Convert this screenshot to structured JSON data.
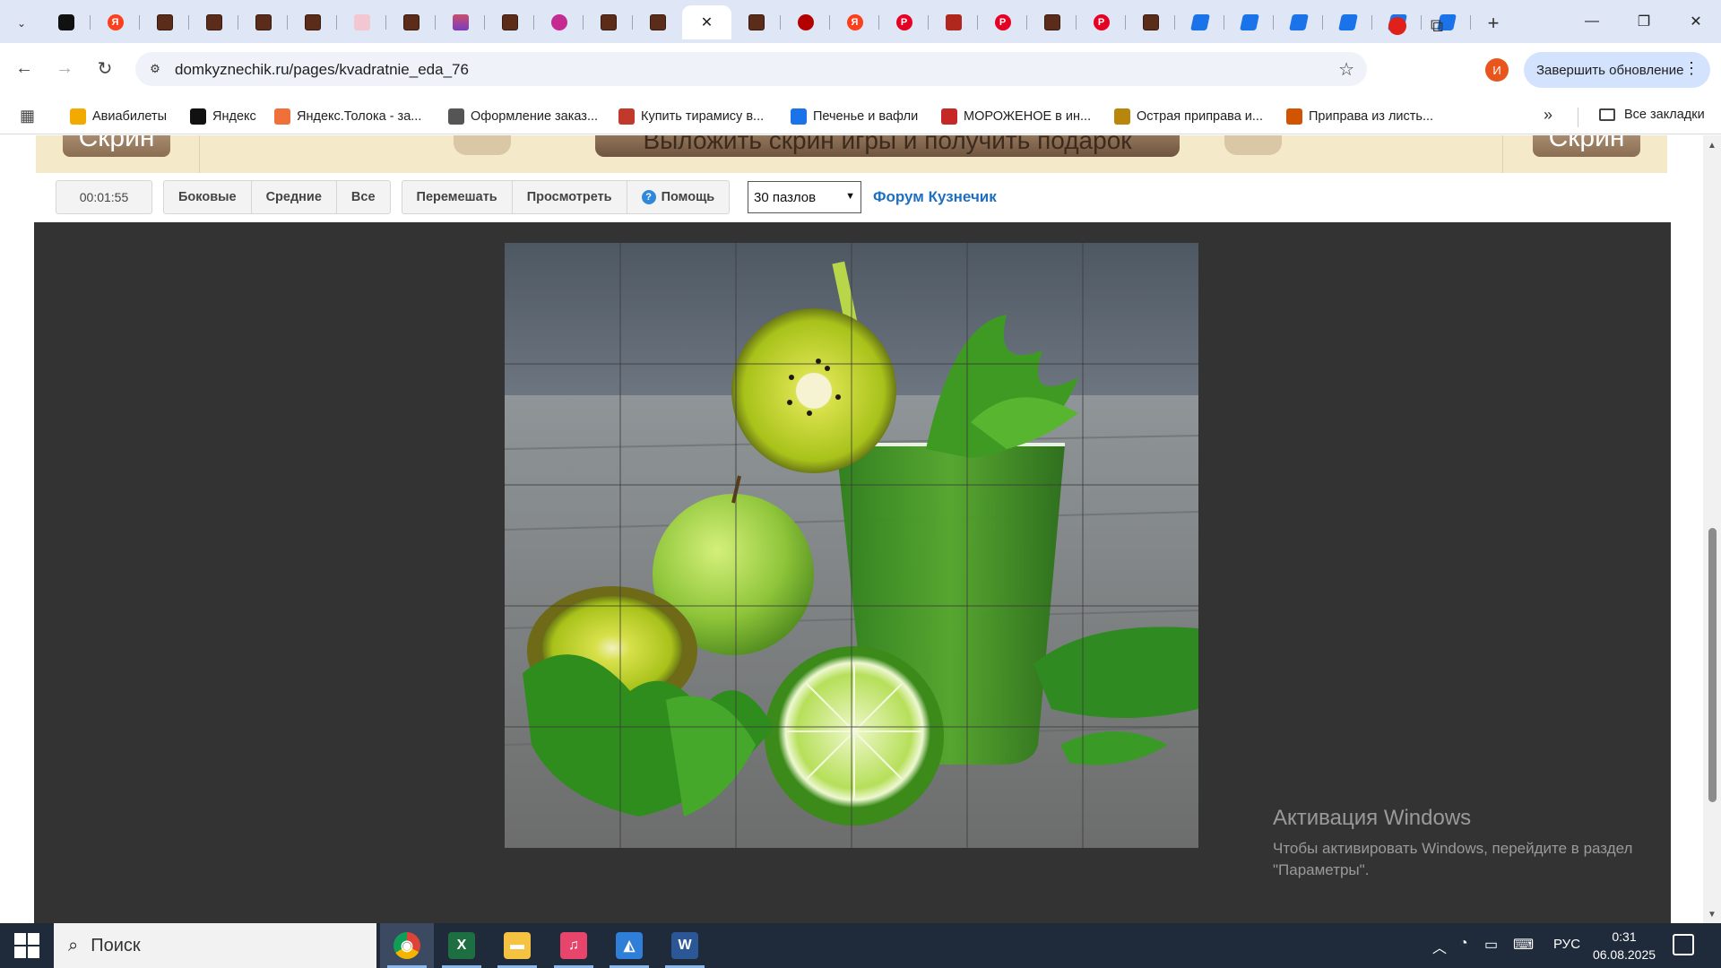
{
  "tabs": [
    {
      "icon": "plus",
      "label": ""
    },
    {
      "icon": "yandex",
      "label": "Я"
    },
    {
      "icon": "site",
      "label": ""
    },
    {
      "icon": "site",
      "label": ""
    },
    {
      "icon": "site",
      "label": ""
    },
    {
      "icon": "site",
      "label": ""
    },
    {
      "icon": "doc",
      "label": ""
    },
    {
      "icon": "site",
      "label": ""
    },
    {
      "icon": "bars",
      "label": ""
    },
    {
      "icon": "site",
      "label": ""
    },
    {
      "icon": "flower",
      "label": ""
    },
    {
      "icon": "site",
      "label": ""
    },
    {
      "icon": "site",
      "label": ""
    },
    {
      "icon": "close",
      "label": "✕",
      "active": true
    },
    {
      "icon": "site",
      "label": ""
    },
    {
      "icon": "red",
      "label": ""
    },
    {
      "icon": "yandex",
      "label": "Я"
    },
    {
      "icon": "pin",
      "label": "P"
    },
    {
      "icon": "man",
      "label": ""
    },
    {
      "icon": "pin",
      "label": "P"
    },
    {
      "icon": "site",
      "label": ""
    },
    {
      "icon": "pin",
      "label": "P"
    },
    {
      "icon": "site",
      "label": ""
    },
    {
      "icon": "arrow",
      "label": ""
    },
    {
      "icon": "arrow",
      "label": ""
    },
    {
      "icon": "arrow",
      "label": ""
    },
    {
      "icon": "arrow",
      "label": ""
    },
    {
      "icon": "arrow",
      "label": ""
    },
    {
      "icon": "arrow",
      "label": ""
    }
  ],
  "toolbar": {
    "url": "domkyznechik.ru/pages/kvadratnie_eda_76",
    "avatar_letter": "И",
    "update_label": "Завершить обновление"
  },
  "bookmarks": [
    {
      "label": "Авиабилеты",
      "color": "#f2a900"
    },
    {
      "label": "Яндекс",
      "color": "#111111"
    },
    {
      "label": "Яндекс.Толока - за...",
      "color": "#f0703a"
    },
    {
      "label": "Оформление заказ...",
      "color": "#555555"
    },
    {
      "label": "Купить тирамису в...",
      "color": "#c0392b"
    },
    {
      "label": "Печенье и вафли",
      "color": "#1a73e8"
    },
    {
      "label": "МОРОЖЕНОЕ в ин...",
      "color": "#c62828"
    },
    {
      "label": "Острая приправа и...",
      "color": "#b8860b"
    },
    {
      "label": "Приправа из листь...",
      "color": "#d35400"
    }
  ],
  "all_bookmarks": "Все закладки",
  "banner": {
    "left_btn": "Скрин",
    "center": "Выложить скрин игры и получить подарок",
    "right_btn": "Скрин"
  },
  "controls": {
    "timer": "00:01:55",
    "pieces": [
      "Боковые",
      "Средние",
      "Все"
    ],
    "actions": [
      "Перемешать",
      "Просмотреть",
      "Помощь"
    ],
    "select_value": "30 пазлов",
    "forum": "Форум Кузнечик"
  },
  "puzzle": {
    "cols": 6,
    "rows": 5
  },
  "activation": {
    "title": "Активация Windows",
    "line1": "Чтобы активировать Windows, перейдите в раздел",
    "line2": "\"Параметры\"."
  },
  "taskbar": {
    "search_placeholder": "Поиск",
    "apps": [
      {
        "name": "chrome",
        "color": "#ffffff"
      },
      {
        "name": "excel",
        "color": "#1d6f42"
      },
      {
        "name": "explorer",
        "color": "#f5c242"
      },
      {
        "name": "itunes",
        "color": "#e8456c"
      },
      {
        "name": "paint",
        "color": "#2f7fd8"
      },
      {
        "name": "word",
        "color": "#2b5797"
      }
    ],
    "lang": "РУС",
    "time": "0:31",
    "date": "06.08.2025"
  }
}
